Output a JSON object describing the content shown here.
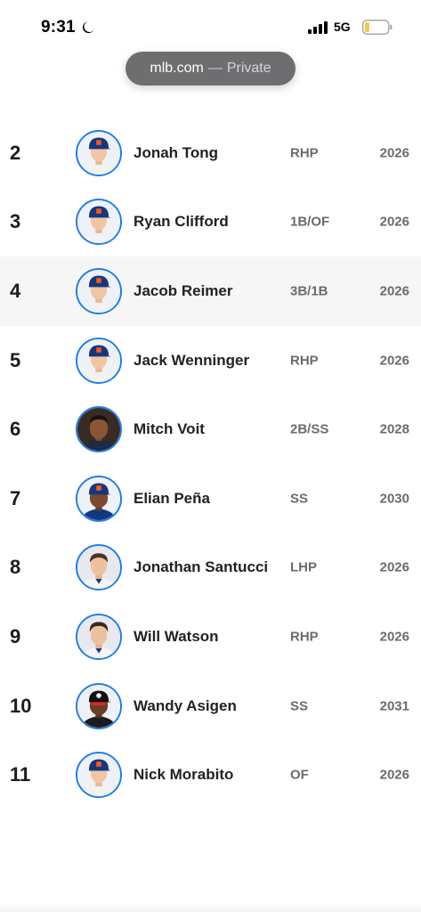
{
  "status_bar": {
    "time": "9:31",
    "network": "5G",
    "icons": [
      "moon-icon",
      "signal-icon",
      "battery-icon"
    ]
  },
  "browser": {
    "host": "mlb.com",
    "separator": "—",
    "mode": "Private"
  },
  "colors": {
    "avatar_ring": "#1e7ee8",
    "row_highlight": "#f6f6f6",
    "url_pill": "#6e6e70"
  },
  "prospects": [
    {
      "rank": "2",
      "name": "Jonah Tong",
      "position": "RHP",
      "eta": "2026"
    },
    {
      "rank": "3",
      "name": "Ryan Clifford",
      "position": "1B/OF",
      "eta": "2026"
    },
    {
      "rank": "4",
      "name": "Jacob Reimer",
      "position": "3B/1B",
      "eta": "2026"
    },
    {
      "rank": "5",
      "name": "Jack Wenninger",
      "position": "RHP",
      "eta": "2026"
    },
    {
      "rank": "6",
      "name": "Mitch Voit",
      "position": "2B/SS",
      "eta": "2028"
    },
    {
      "rank": "7",
      "name": "Elian Peña",
      "position": "SS",
      "eta": "2030"
    },
    {
      "rank": "8",
      "name": "Jonathan Santucci",
      "position": "LHP",
      "eta": "2026"
    },
    {
      "rank": "9",
      "name": "Will Watson",
      "position": "RHP",
      "eta": "2026"
    },
    {
      "rank": "10",
      "name": "Wandy Asigen",
      "position": "SS",
      "eta": "2031"
    },
    {
      "rank": "11",
      "name": "Nick Morabito",
      "position": "OF",
      "eta": "2026"
    }
  ]
}
